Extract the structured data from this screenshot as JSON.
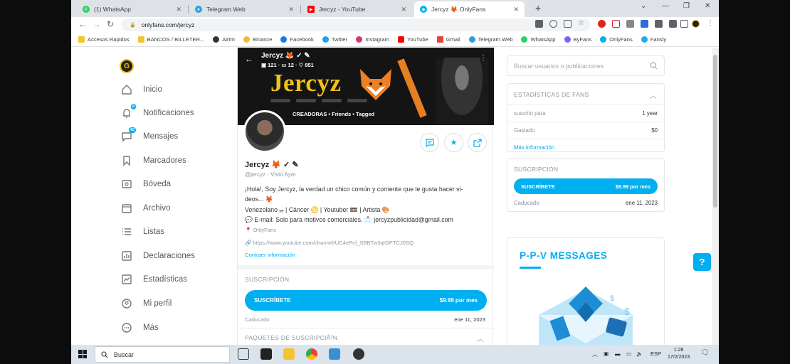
{
  "browser": {
    "tabs": [
      {
        "label": "(1) WhatsApp",
        "color": "#25d366"
      },
      {
        "label": "Telegram Web",
        "color": "#2aa1da"
      },
      {
        "label": "Jercyz - YouTube",
        "color": "#ff0000"
      },
      {
        "label": "Jercyz 🦊 OnlyFans",
        "color": "#00aff0"
      }
    ],
    "url": "onlyfans.com/jercyz",
    "bookmarks": [
      {
        "label": "Accesos Rapidos",
        "color": "#f4c430"
      },
      {
        "label": "BANCOS / BILLETER...",
        "color": "#f4c430"
      },
      {
        "label": "Airtm",
        "color": "#333333"
      },
      {
        "label": "Binance",
        "color": "#f3ba2f"
      },
      {
        "label": "Facebook",
        "color": "#1877f2"
      },
      {
        "label": "Twitter",
        "color": "#1da1f2"
      },
      {
        "label": "Instagram",
        "color": "#e1306c"
      },
      {
        "label": "YouTube",
        "color": "#ff0000"
      },
      {
        "label": "Gmail",
        "color": "#ea4335"
      },
      {
        "label": "Telegram Web",
        "color": "#2aa1da"
      },
      {
        "label": "WhatsApp",
        "color": "#25d366"
      },
      {
        "label": "ByFans",
        "color": "#7b61ff"
      },
      {
        "label": "OnlyFans",
        "color": "#00aff0"
      },
      {
        "label": "Fansly",
        "color": "#1fa7f8"
      }
    ]
  },
  "sidebar": {
    "logo": "G",
    "items": [
      {
        "label": "Inicio",
        "icon": "home-icon"
      },
      {
        "label": "Notificaciones",
        "icon": "bell-icon",
        "badge": "6"
      },
      {
        "label": "Mensajes",
        "icon": "message-icon",
        "badge": "42"
      },
      {
        "label": "Marcadores",
        "icon": "bookmark-icon"
      },
      {
        "label": "Bóveda",
        "icon": "vault-icon"
      },
      {
        "label": "Archivo",
        "icon": "archive-icon"
      },
      {
        "label": "Listas",
        "icon": "list-icon"
      },
      {
        "label": "Declaraciones",
        "icon": "statements-icon"
      },
      {
        "label": "Estadísticas",
        "icon": "stats-icon"
      },
      {
        "label": "Mi perfil",
        "icon": "profile-icon"
      },
      {
        "label": "Más",
        "icon": "more-icon"
      }
    ]
  },
  "profile": {
    "banner_name": "Jercyz 🦊 ✓ ✎",
    "banner_stats": "▣ 121 · ▭ 12 · ♡ 851",
    "banner_title": "Jercyz",
    "banner_tabs": "CREADORAS • Friends • Tagged",
    "name": "Jercyz 🦊 ✓ ✎",
    "handle": "@jercyz · Visto Ayer",
    "bio": [
      "¡Hola!, Soy Jercyz, la verdad un chico común y corriente que le gusta hacer vi-",
      "deos... 🦊",
      "Venezolano ᵥₑ | Cáncer ♋ | Youtuber 📼 | Artista 🎨",
      "💬 E-mail: Solo para motivos comerciales. 📩 jercyzpublicidad@gmail.com",
      "📍 OnlyFans"
    ],
    "youtube_link": "https://www.youtube.com/channel/UC4ePcf_SBBTw3qIGPTCJ0SQ",
    "collapse_label": "Contraer información"
  },
  "subscription": {
    "label": "SUSCRIPCIÓN",
    "button": "SUSCRÍBETE",
    "price": "$9.99 por mes",
    "expired_label": "Caducado",
    "expired_date": "ene 11, 2023",
    "packages_label": "PAQUETES DE SUSCRIPCIÃ³N"
  },
  "right": {
    "search_placeholder": "Buscar usuarios o publicaciones",
    "stats": {
      "title": "ESTADÍSTICAS DE FANS",
      "subscribed_label": "suscrito para",
      "subscribed_value": "1 year",
      "spent_label": "Gastado",
      "spent_value": "$0",
      "more": "Más información"
    },
    "subscription": {
      "title": "SUSCRIPCIÓN",
      "button": "SUSCRÍBETE",
      "price": "$9.99 por mes",
      "expired_label": "Caducado",
      "expired_date": "ene 11, 2023"
    },
    "ppv_title": "P-P-V  MESSAGES"
  },
  "taskbar": {
    "search": "Buscar",
    "lang": "ESP",
    "time": "1:28",
    "date": "17/2/2023"
  },
  "colors": {
    "accent": "#00aff0",
    "banner_gold": "#f2c21a"
  }
}
